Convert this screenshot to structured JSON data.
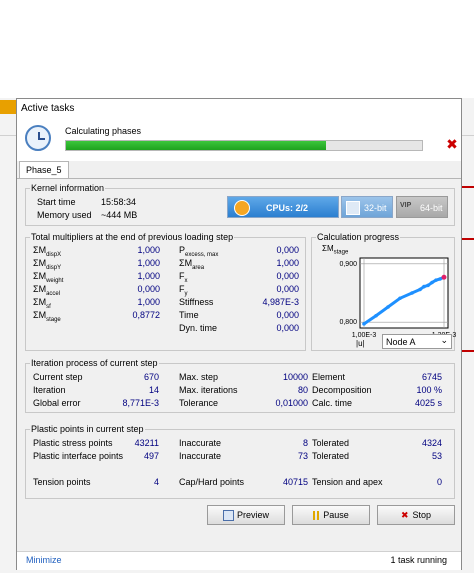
{
  "dialog": {
    "title": "Active tasks"
  },
  "header": {
    "phase_text": "Calculating phases",
    "progress": 0.73
  },
  "tab": {
    "label": "Phase_5"
  },
  "kernel": {
    "title": "Kernel information",
    "start_label": "Start time",
    "start_value": "15:58:34",
    "mem_label": "Memory used",
    "mem_value": "~444 MB",
    "cpus": "CPUs: 2/2",
    "bit32": "32-bit",
    "bit64": "64-bit",
    "vip": "VIP"
  },
  "multipliers": {
    "title": "Total multipliers at the end of previous loading step",
    "left": [
      {
        "sym": "ΣM",
        "sub": "dispX",
        "value": "1,000"
      },
      {
        "sym": "ΣM",
        "sub": "dispY",
        "value": "1,000"
      },
      {
        "sym": "ΣM",
        "sub": "weight",
        "value": "1,000"
      },
      {
        "sym": "ΣM",
        "sub": "accel",
        "value": "0,000"
      },
      {
        "sym": "ΣM",
        "sub": "sf",
        "value": "1,000"
      },
      {
        "sym": "ΣM",
        "sub": "stage",
        "value": "0,8772"
      }
    ],
    "right": [
      {
        "sym": "P",
        "sub": "excess, max",
        "value": "0,000"
      },
      {
        "sym": "ΣM",
        "sub": "area",
        "value": "1,000"
      },
      {
        "sym": "F",
        "sub": "x",
        "value": "0,000"
      },
      {
        "sym": "F",
        "sub": "y",
        "value": "0,000"
      },
      {
        "sym": "Stiffness",
        "sub": "",
        "value": "4,987E-3"
      },
      {
        "sym": "Time",
        "sub": "",
        "value": "0,000"
      },
      {
        "sym": "Dyn. time",
        "sub": "",
        "value": "0,000"
      }
    ]
  },
  "progress_chart": {
    "title": "Calculation progress",
    "yaxis_sym": "ΣM",
    "yaxis_sub": "stage",
    "u_label": "|u|",
    "node_select": "Node A"
  },
  "chart_data": {
    "type": "line",
    "x_ticks": [
      "1,00E-3",
      "1,20E-3"
    ],
    "y_ticks": [
      "0,900",
      "0,800"
    ],
    "xlim": [
      0.00099,
      0.00121
    ],
    "ylim": [
      0.79,
      0.91
    ],
    "grid": true,
    "series": [
      {
        "color": "#1e90ff",
        "x": [
          0.001,
          0.00103,
          0.00106,
          0.00109,
          0.00112,
          0.00114,
          0.00115,
          0.00116,
          0.00117,
          0.00118,
          0.00119,
          0.0012
        ],
        "y": [
          0.797,
          0.811,
          0.826,
          0.841,
          0.85,
          0.856,
          0.861,
          0.863,
          0.868,
          0.872,
          0.874,
          0.877
        ]
      }
    ],
    "last_point_color": "#e0206a"
  },
  "iteration": {
    "title": "Iteration process of current step",
    "col1": [
      {
        "label": "Current step",
        "value": "670"
      },
      {
        "label": "Iteration",
        "value": "14"
      },
      {
        "label": "Global error",
        "value": "8,771E-3"
      }
    ],
    "col2": [
      {
        "label": "Max. step",
        "value": "10000"
      },
      {
        "label": "Max. iterations",
        "value": "80"
      },
      {
        "label": "Tolerance",
        "value": "0,01000"
      }
    ],
    "col3": [
      {
        "label": "Element",
        "value": "6745"
      },
      {
        "label": "Decomposition",
        "value": "100 %"
      },
      {
        "label": "Calc. time",
        "value": "4025 s"
      }
    ]
  },
  "plastic": {
    "title": "Plastic points in current step",
    "col1": [
      {
        "label": "Plastic stress points",
        "value": "43211"
      },
      {
        "label": "Plastic interface points",
        "value": "497"
      },
      {
        "label": "Tension points",
        "value": "4"
      }
    ],
    "col2": [
      {
        "label": "Inaccurate",
        "value": "8"
      },
      {
        "label": "Inaccurate",
        "value": "73"
      },
      {
        "label": "Cap/Hard points",
        "value": "40715"
      }
    ],
    "col3": [
      {
        "label": "Tolerated",
        "value": "4324"
      },
      {
        "label": "Tolerated",
        "value": "53"
      },
      {
        "label": "Tension and apex",
        "value": "0"
      }
    ]
  },
  "buttons": {
    "preview": "Preview",
    "pause": "Pause",
    "stop": "Stop"
  },
  "footer": {
    "minimize": "Minimize",
    "status": "1 task running"
  }
}
